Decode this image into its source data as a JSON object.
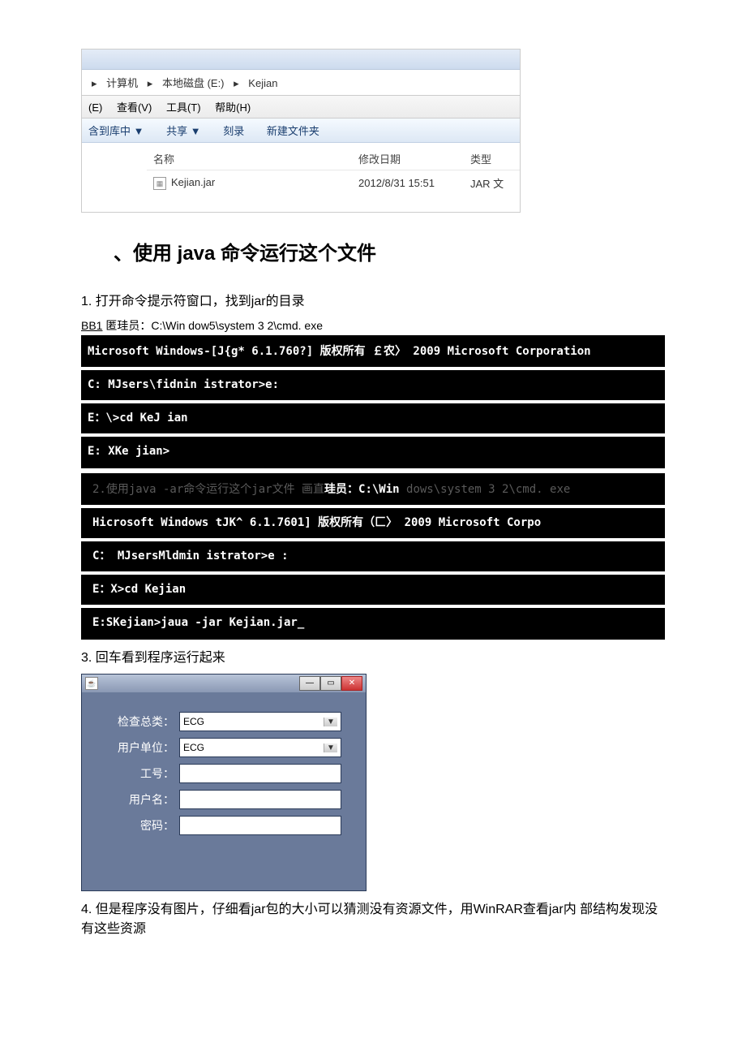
{
  "explorer": {
    "breadcrumb": {
      "seg1": "计算机",
      "seg2": "本地磁盘 (E:)",
      "seg3": "Kejian"
    },
    "menu": {
      "edit": "(E)",
      "view": "查看(V)",
      "tools": "工具(T)",
      "help": "帮助(H)"
    },
    "toolbar": {
      "library": "含到库中 ▼",
      "share": "共享 ▼",
      "burn": "刻录",
      "newfolder": "新建文件夹"
    },
    "columns": {
      "name": "名称",
      "date": "修改日期",
      "type": "类型"
    },
    "row": {
      "name": "Kejian.jar",
      "date": "2012/8/31 15:51",
      "type": "JAR 文"
    }
  },
  "heading": "、使用  java 命令运行这个文件",
  "step1": "1.    打开命令提示符窗口，找到jar的目录",
  "caption1a": "BB1",
  "caption1b": " 匿珪员：C:\\Win dow5\\system 3 2\\cmd. exe",
  "cmd1": {
    "l1": "Microsoft Windows-[J{g* 6.1.760?] 版权所有 ￡农〉 2009 Microsoft Corporation",
    "l2": "C: MJsers\\fidnin istrator>e:",
    "l3": "E：\\>cd KeJ ian",
    "l4": "E: XKe jian>"
  },
  "midline_a": "2.使用java -ar命令运行这个jar文件  画直",
  "midline_b": "珪员：",
  "midline_c": "C:\\Win",
  "midline_d": " dows\\system 3 2\\cmd. exe",
  "cmd2": {
    "l1": "Hicrosoft Windows tJK^ 6.1.7601] 版权所有（匚〉 2009 Microsoft Corpo",
    "l2": "C：  MJsersMldmin istrator>e :",
    "l3": "E：X>cd Kejian",
    "l4": "E:SKejian>jaua -jar Kejian.jar_"
  },
  "step3": "3. 回车看到程序运行起来",
  "app": {
    "labels": {
      "type": "检查总类：",
      "unit": "用户单位：",
      "id": "工号：",
      "user": "用户名：",
      "pwd": "密码："
    },
    "values": {
      "type": "ECG",
      "unit": "ECG"
    }
  },
  "step4": "4. 但是程序没有图片，仔细看jar包的大小可以猜测没有资源文件，用WinRAR查看jar内  部结构发现没有这些资源"
}
